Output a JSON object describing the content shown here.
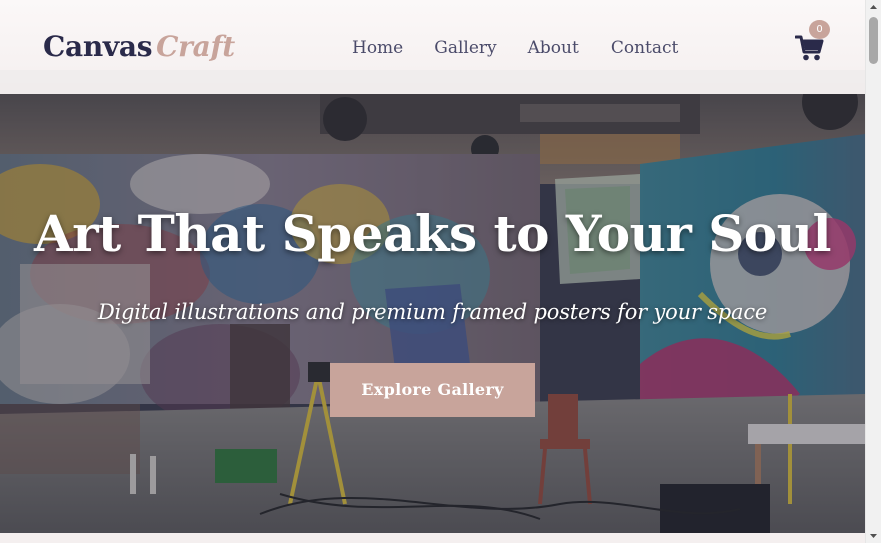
{
  "header": {
    "logo_primary": "Canvas",
    "logo_accent": "Craft",
    "nav": {
      "home": "Home",
      "gallery": "Gallery",
      "about": "About",
      "contact": "Contact"
    },
    "cart": {
      "icon": "shopping-cart-icon",
      "count": "0"
    }
  },
  "hero": {
    "title": "Art That Speaks to Your Soul",
    "subtitle": "Digital illustrations and premium framed posters for your space",
    "cta_label": "Explore Gallery",
    "background": "graffiti-art-studio-photo"
  },
  "colors": {
    "brand_dark": "#2a2a4a",
    "brand_accent": "#c8a49b",
    "nav_text": "#4b4b6a",
    "hero_text": "#ffffff"
  },
  "scrollbar": {
    "position": 0
  }
}
